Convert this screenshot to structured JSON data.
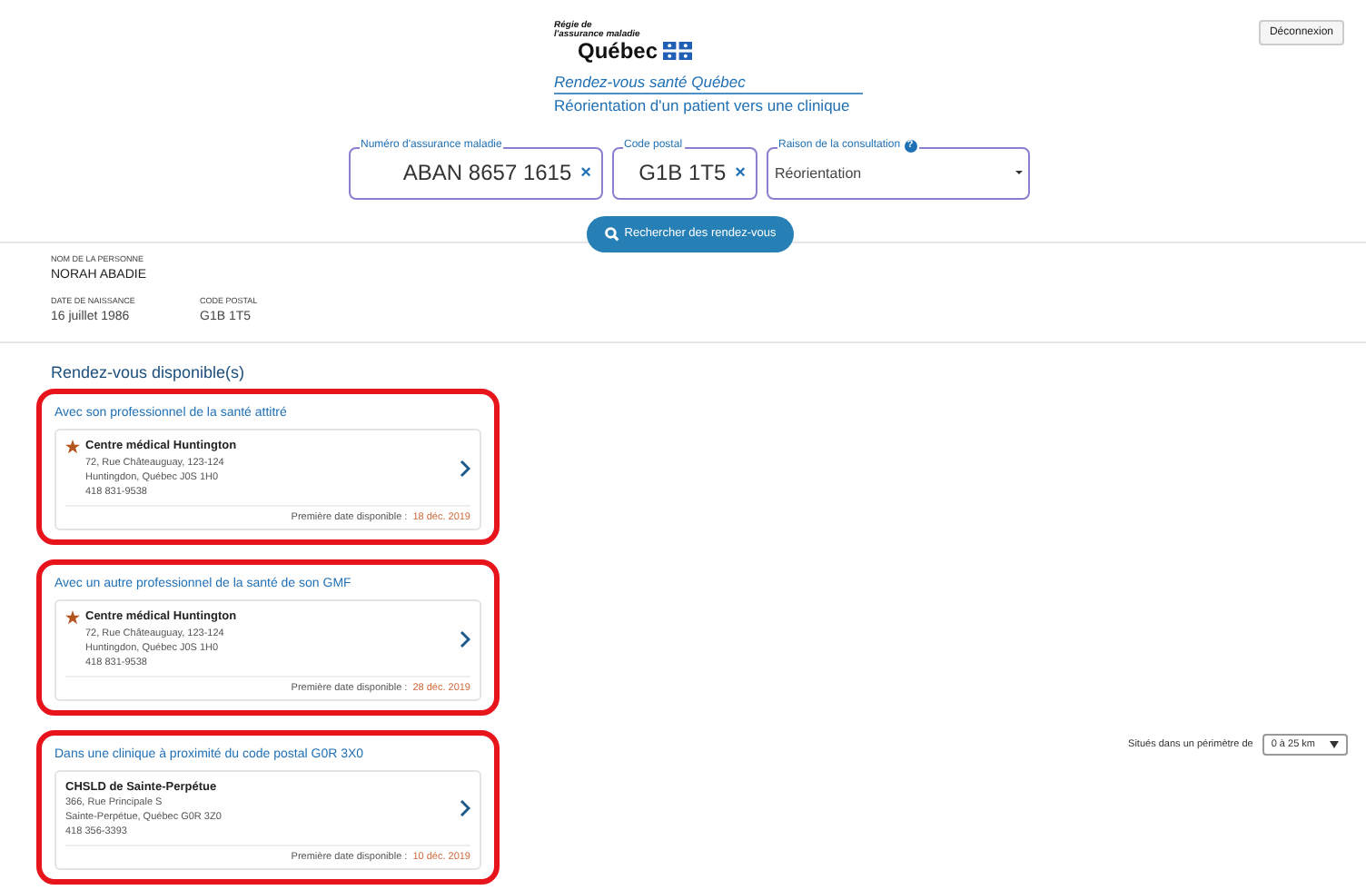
{
  "header": {
    "logo_lines": [
      "Régie de",
      "l'assurance maladie",
      "Québec"
    ],
    "title": "Rendez-vous santé Québec",
    "subtitle": "Réorientation d'un patient vers une clinique",
    "logout": "Déconnexion"
  },
  "search": {
    "fields": [
      {
        "kind": "clearable",
        "label": "Numéro d'assurance maladie",
        "value": "ABAN 8657 1615",
        "clear": "×"
      },
      {
        "kind": "clearable",
        "label": "Code postal",
        "value": "G1B 1T5",
        "clear": "×"
      },
      {
        "kind": "select",
        "label": "Raison de la consultation",
        "help": "?",
        "value": "Réorientation"
      }
    ],
    "button": "Rechercher des rendez-vous"
  },
  "person": {
    "name_label": "NOM DE LA PERSONNE",
    "name": "NORAH ABADIE",
    "details": [
      {
        "label": "DATE DE NAISSANCE",
        "value": "16 juillet 1986"
      },
      {
        "label": "CODE POSTAL",
        "value": "G1B 1T5"
      }
    ]
  },
  "heading": "Rendez-vous disponible(s)",
  "sections": [
    {
      "title": "Avec son professionnel de la santé attitré",
      "highlighted": true,
      "clinic": {
        "favorite": true,
        "name": "Centre médical Huntington",
        "lines": [
          "72, Rue Châteauguay, 123-124",
          "Huntingdon, Québec J0S 1H0",
          "418 831-9538"
        ]
      },
      "date_label": "Première date disponible :",
      "date": "18 déc. 2019"
    },
    {
      "title": "Avec un autre professionnel de la santé de son GMF",
      "highlighted": true,
      "clinic": {
        "favorite": true,
        "name": "Centre médical Huntington",
        "lines": [
          "72, Rue Châteauguay, 123-124",
          "Huntingdon, Québec J0S 1H0",
          "418 831-9538"
        ]
      },
      "date_label": "Première date disponible :",
      "date": "28 déc. 2019"
    },
    {
      "title": "Dans une clinique à proximité du code postal G0R 3X0",
      "highlighted": true,
      "clinic": {
        "favorite": false,
        "name": "CHSLD de Sainte-Perpétue",
        "lines": [
          "366, Rue Principale S",
          "Sainte-Perpétue, Québec G0R 3Z0",
          "418 356-3393"
        ]
      },
      "date_label": "Première date disponible :",
      "date": "10 déc. 2019",
      "radius": {
        "label": "Situés dans un périmètre de",
        "value": "0 à 25 km"
      }
    }
  ]
}
